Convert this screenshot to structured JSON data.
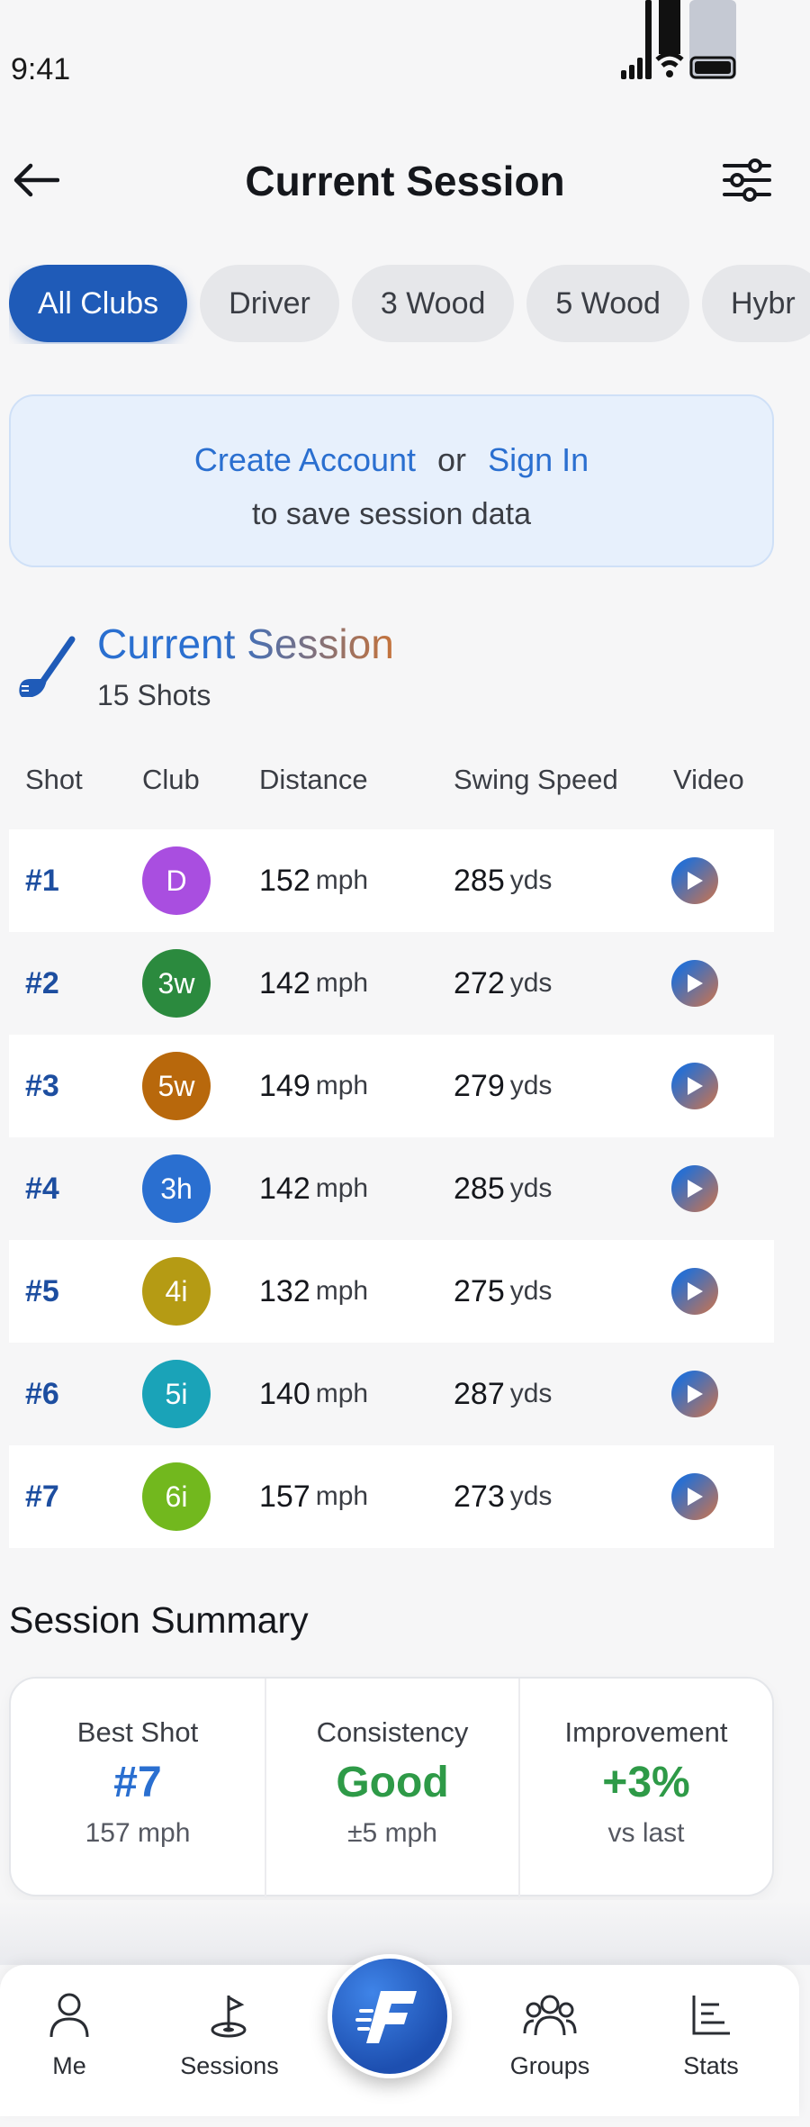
{
  "status": {
    "time": "9:41"
  },
  "header": {
    "title": "Current Session"
  },
  "chips": [
    "All Clubs",
    "Driver",
    "3 Wood",
    "5 Wood",
    "Hybr"
  ],
  "account_prompt": {
    "create_label": "Create Account",
    "or_text": "or",
    "signin_label": "Sign In",
    "subtext": "to save session data"
  },
  "session": {
    "title": "Current Session",
    "shots_label": "15 Shots"
  },
  "table": {
    "headers": [
      "Shot",
      "Club",
      "Distance",
      "Swing Speed",
      "Video"
    ],
    "rows": [
      {
        "shot": "#1",
        "club": "D",
        "club_color": "#a94ee0",
        "distance": "152",
        "distance_unit": "mph",
        "speed": "285",
        "speed_unit": "yds"
      },
      {
        "shot": "#2",
        "club": "3w",
        "club_color": "#2b8a3e",
        "distance": "142",
        "distance_unit": "mph",
        "speed": "272",
        "speed_unit": "yds"
      },
      {
        "shot": "#3",
        "club": "5w",
        "club_color": "#b8680c",
        "distance": "149",
        "distance_unit": "mph",
        "speed": "279",
        "speed_unit": "yds"
      },
      {
        "shot": "#4",
        "club": "3h",
        "club_color": "#2a6fd0",
        "distance": "142",
        "distance_unit": "mph",
        "speed": "285",
        "speed_unit": "yds"
      },
      {
        "shot": "#5",
        "club": "4i",
        "club_color": "#b59b14",
        "distance": "132",
        "distance_unit": "mph",
        "speed": "275",
        "speed_unit": "yds"
      },
      {
        "shot": "#6",
        "club": "5i",
        "club_color": "#1aa3b8",
        "distance": "140",
        "distance_unit": "mph",
        "speed": "287",
        "speed_unit": "yds"
      },
      {
        "shot": "#7",
        "club": "6i",
        "club_color": "#72b81e",
        "distance": "157",
        "distance_unit": "mph",
        "speed": "273",
        "speed_unit": "yds"
      }
    ]
  },
  "summary": {
    "title": "Session Summary",
    "best_shot": {
      "label": "Best Shot",
      "value": "#7",
      "sub": "157 mph",
      "color": "#2a6fd0"
    },
    "consistency": {
      "label": "Consistency",
      "value": "Good",
      "sub": "±5 mph",
      "color": "#2e9a47"
    },
    "improvement": {
      "label": "Improvement",
      "value": "+3%",
      "sub": "vs last",
      "color": "#2e9a47"
    }
  },
  "nav": {
    "items": [
      "Me",
      "Sessions",
      "Groups",
      "Stats"
    ],
    "fab_letter": "F"
  },
  "icons": {
    "back": "arrow-left-icon",
    "filter": "sliders-icon",
    "club": "golf-club-icon",
    "play": "play-icon"
  }
}
